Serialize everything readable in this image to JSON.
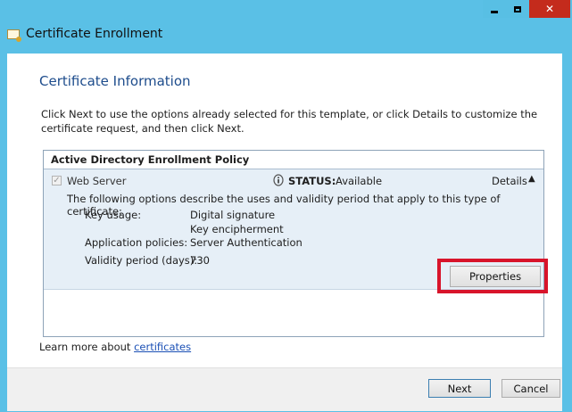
{
  "window": {
    "title": "Certificate Enrollment",
    "controls": {
      "minimize": "–",
      "maximize": "□",
      "close": "✕"
    }
  },
  "page": {
    "heading": "Certificate Information",
    "intro": "Click Next to use the options already selected for this template, or click Details to customize the certificate request, and then click Next."
  },
  "policy": {
    "header": "Active Directory Enrollment Policy",
    "item": {
      "name": "Web Server",
      "checked": true,
      "status_label": "STATUS:",
      "status_value": "Available",
      "details_label": "Details",
      "description": "The following options describe the uses and validity period that apply to this type of certificate:",
      "properties": [
        {
          "label": "Key usage:",
          "values": [
            "Digital signature",
            "Key encipherment"
          ]
        },
        {
          "label": "Application policies:",
          "values": [
            "Server Authentication"
          ]
        },
        {
          "label": "Validity period (days):",
          "values": [
            "730"
          ]
        }
      ],
      "properties_button": "Properties"
    }
  },
  "learn_more": {
    "text": "Learn more about",
    "link": "certificates"
  },
  "footer": {
    "next": "Next",
    "cancel": "Cancel"
  },
  "colors": {
    "frame": "#5ac0e6",
    "highlight": "#d8142b",
    "heading": "#1d4c8c",
    "item_bg": "#e6eff7"
  }
}
